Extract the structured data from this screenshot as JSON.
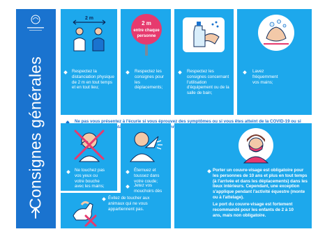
{
  "sidebar": {
    "title": "Consignes générales",
    "logo_icon": "organization-logo-icon",
    "up_icon": "arrow-up-icon"
  },
  "tiles": [
    {
      "icon": "distance-two-meters-icon",
      "icon_label": "2 m",
      "text": "Respectez la distanciation physique de 2 m en tout temps et en tout lieu;"
    },
    {
      "icon": "distance-sign-icon",
      "sign_line1": "2 m",
      "sign_line2": "entre chaque",
      "sign_line3": "personne",
      "text": "Respectez les consignes pour les déplacements;"
    },
    {
      "icon": "cleaning-spray-icon",
      "text": "Respectez les consignes concernant l'utilisation d'équipement ou de la salle de bain;"
    },
    {
      "icon": "hand-washing-icon",
      "text": "Lavez fréquemment vos mains;"
    }
  ],
  "banner": {
    "text": "Ne pas vous présentez à l'écurie si vous éprouvez des symptômes ou si vous êtes atteint de la COVID-19 ou si vous avez été en contact étroit avec une personne symptomatique ou placée en isolation en raison de la COVID-19."
  },
  "tiles2": [
    {
      "icon": "no-face-touching-icon",
      "text": "Ne touchez pas vos yeux ou votre bouche avec les mains;"
    },
    {
      "icon": "sneeze-in-elbow-icon",
      "text1": "Éternuez et toussez dans votre coude;",
      "text2": "Jetez vos mouchoirs dès utilisation;"
    },
    {
      "icon": "face-mask-person-icon",
      "text1": "Porter un couvre-visage est obligatoire pour les personnes de 10 ans et plus en tout temps (à l'arrivée et dans les déplacements) dans les lieux intérieurs. Cependant, une exception s'applique pendant l'activité équestre (monte ou à l'attelage).",
      "text2": "Le port du couvre-visage est fortement recommandé pour les enfants de 2 à 10 ans, mais non obligatoire."
    },
    {
      "icon": "no-animal-touching-icon",
      "text": "Évitez de toucher aux animaux qui ne vous appartiennent pas."
    }
  ],
  "colors": {
    "accent": "#1a73cf",
    "tile": "#1da8ec",
    "warning": "#e63a6e"
  }
}
